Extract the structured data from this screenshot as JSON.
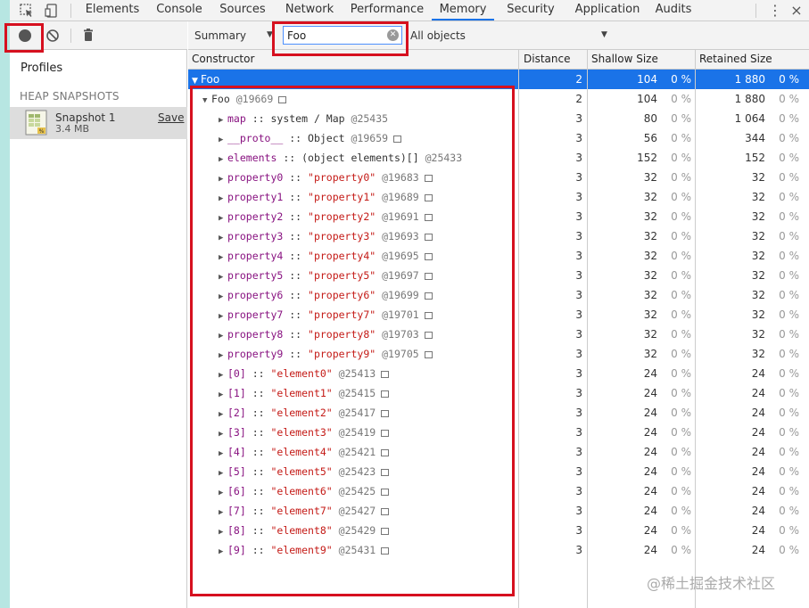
{
  "colors": {
    "accent_strip": "#b7e6e2",
    "selection": "#1a73e8",
    "annotation": "#d6101f",
    "property_name": "#881280",
    "string_value": "#c41a16"
  },
  "tabbar": {
    "tabs": [
      {
        "label": "Elements",
        "active": false
      },
      {
        "label": "Console",
        "active": false
      },
      {
        "label": "Sources",
        "active": false
      },
      {
        "label": "Network",
        "active": false
      },
      {
        "label": "Performance",
        "active": false
      },
      {
        "label": "Memory",
        "active": true
      },
      {
        "label": "Security",
        "active": false
      },
      {
        "label": "Application",
        "active": false
      },
      {
        "label": "Audits",
        "active": false
      }
    ],
    "menu_icon": "⋮",
    "close_icon": "×"
  },
  "sidebar": {
    "profiles_title": "Profiles",
    "heap_heading": "HEAP SNAPSHOTS",
    "snapshot": {
      "name": "Snapshot 1",
      "size": "3.4 MB",
      "save_label": "Save"
    }
  },
  "toolbar": {
    "view": "Summary",
    "filter_value": "Foo",
    "objects": "All objects"
  },
  "table": {
    "columns": [
      "Constructor",
      "Distance",
      "Shallow Size",
      "Retained Size"
    ],
    "root": {
      "name": "Foo",
      "distance": "2",
      "shallow": "104",
      "shallow_pct": "0 %",
      "retained": "1 880",
      "retained_pct": "0 %"
    },
    "instance": {
      "name": "Foo",
      "id": "@19669",
      "distance": "2",
      "shallow": "104",
      "shallow_pct": "0 %",
      "retained": "1 880",
      "retained_pct": "0 %"
    },
    "rows": [
      {
        "name": "map",
        "sep": " :: ",
        "type": "system / Map",
        "id": "@25435",
        "distance": "3",
        "shallow": "80",
        "shallow_pct": "0 %",
        "retained": "1 064",
        "retained_pct": "0 %"
      },
      {
        "name": "__proto__",
        "sep": " :: ",
        "type": "Object",
        "id": "@19659",
        "distance": "3",
        "shallow": "56",
        "shallow_pct": "0 %",
        "retained": "344",
        "retained_pct": "0 %"
      },
      {
        "name": "elements",
        "sep": " :: ",
        "type": "(object elements)[]",
        "id": "@25433",
        "distance": "3",
        "shallow": "152",
        "shallow_pct": "0 %",
        "retained": "152",
        "retained_pct": "0 %"
      },
      {
        "name": "property0",
        "sep": " :: ",
        "value": "\"property0\"",
        "id": "@19683",
        "distance": "3",
        "shallow": "32",
        "shallow_pct": "0 %",
        "retained": "32",
        "retained_pct": "0 %"
      },
      {
        "name": "property1",
        "sep": " :: ",
        "value": "\"property1\"",
        "id": "@19689",
        "distance": "3",
        "shallow": "32",
        "shallow_pct": "0 %",
        "retained": "32",
        "retained_pct": "0 %"
      },
      {
        "name": "property2",
        "sep": " :: ",
        "value": "\"property2\"",
        "id": "@19691",
        "distance": "3",
        "shallow": "32",
        "shallow_pct": "0 %",
        "retained": "32",
        "retained_pct": "0 %"
      },
      {
        "name": "property3",
        "sep": " :: ",
        "value": "\"property3\"",
        "id": "@19693",
        "distance": "3",
        "shallow": "32",
        "shallow_pct": "0 %",
        "retained": "32",
        "retained_pct": "0 %"
      },
      {
        "name": "property4",
        "sep": " :: ",
        "value": "\"property4\"",
        "id": "@19695",
        "distance": "3",
        "shallow": "32",
        "shallow_pct": "0 %",
        "retained": "32",
        "retained_pct": "0 %"
      },
      {
        "name": "property5",
        "sep": " :: ",
        "value": "\"property5\"",
        "id": "@19697",
        "distance": "3",
        "shallow": "32",
        "shallow_pct": "0 %",
        "retained": "32",
        "retained_pct": "0 %"
      },
      {
        "name": "property6",
        "sep": " :: ",
        "value": "\"property6\"",
        "id": "@19699",
        "distance": "3",
        "shallow": "32",
        "shallow_pct": "0 %",
        "retained": "32",
        "retained_pct": "0 %"
      },
      {
        "name": "property7",
        "sep": " :: ",
        "value": "\"property7\"",
        "id": "@19701",
        "distance": "3",
        "shallow": "32",
        "shallow_pct": "0 %",
        "retained": "32",
        "retained_pct": "0 %"
      },
      {
        "name": "property8",
        "sep": " :: ",
        "value": "\"property8\"",
        "id": "@19703",
        "distance": "3",
        "shallow": "32",
        "shallow_pct": "0 %",
        "retained": "32",
        "retained_pct": "0 %"
      },
      {
        "name": "property9",
        "sep": " :: ",
        "value": "\"property9\"",
        "id": "@19705",
        "distance": "3",
        "shallow": "32",
        "shallow_pct": "0 %",
        "retained": "32",
        "retained_pct": "0 %"
      },
      {
        "name": "[0]",
        "sep": " :: ",
        "value": "\"element0\"",
        "id": "@25413",
        "distance": "3",
        "shallow": "24",
        "shallow_pct": "0 %",
        "retained": "24",
        "retained_pct": "0 %"
      },
      {
        "name": "[1]",
        "sep": " :: ",
        "value": "\"element1\"",
        "id": "@25415",
        "distance": "3",
        "shallow": "24",
        "shallow_pct": "0 %",
        "retained": "24",
        "retained_pct": "0 %"
      },
      {
        "name": "[2]",
        "sep": " :: ",
        "value": "\"element2\"",
        "id": "@25417",
        "distance": "3",
        "shallow": "24",
        "shallow_pct": "0 %",
        "retained": "24",
        "retained_pct": "0 %"
      },
      {
        "name": "[3]",
        "sep": " :: ",
        "value": "\"element3\"",
        "id": "@25419",
        "distance": "3",
        "shallow": "24",
        "shallow_pct": "0 %",
        "retained": "24",
        "retained_pct": "0 %"
      },
      {
        "name": "[4]",
        "sep": " :: ",
        "value": "\"element4\"",
        "id": "@25421",
        "distance": "3",
        "shallow": "24",
        "shallow_pct": "0 %",
        "retained": "24",
        "retained_pct": "0 %"
      },
      {
        "name": "[5]",
        "sep": " :: ",
        "value": "\"element5\"",
        "id": "@25423",
        "distance": "3",
        "shallow": "24",
        "shallow_pct": "0 %",
        "retained": "24",
        "retained_pct": "0 %"
      },
      {
        "name": "[6]",
        "sep": " :: ",
        "value": "\"element6\"",
        "id": "@25425",
        "distance": "3",
        "shallow": "24",
        "shallow_pct": "0 %",
        "retained": "24",
        "retained_pct": "0 %"
      },
      {
        "name": "[7]",
        "sep": " :: ",
        "value": "\"element7\"",
        "id": "@25427",
        "distance": "3",
        "shallow": "24",
        "shallow_pct": "0 %",
        "retained": "24",
        "retained_pct": "0 %"
      },
      {
        "name": "[8]",
        "sep": " :: ",
        "value": "\"element8\"",
        "id": "@25429",
        "distance": "3",
        "shallow": "24",
        "shallow_pct": "0 %",
        "retained": "24",
        "retained_pct": "0 %"
      },
      {
        "name": "[9]",
        "sep": " :: ",
        "value": "\"element9\"",
        "id": "@25431",
        "distance": "3",
        "shallow": "24",
        "shallow_pct": "0 %",
        "retained": "24",
        "retained_pct": "0 %"
      }
    ]
  },
  "watermark": "@稀土掘金技术社区"
}
